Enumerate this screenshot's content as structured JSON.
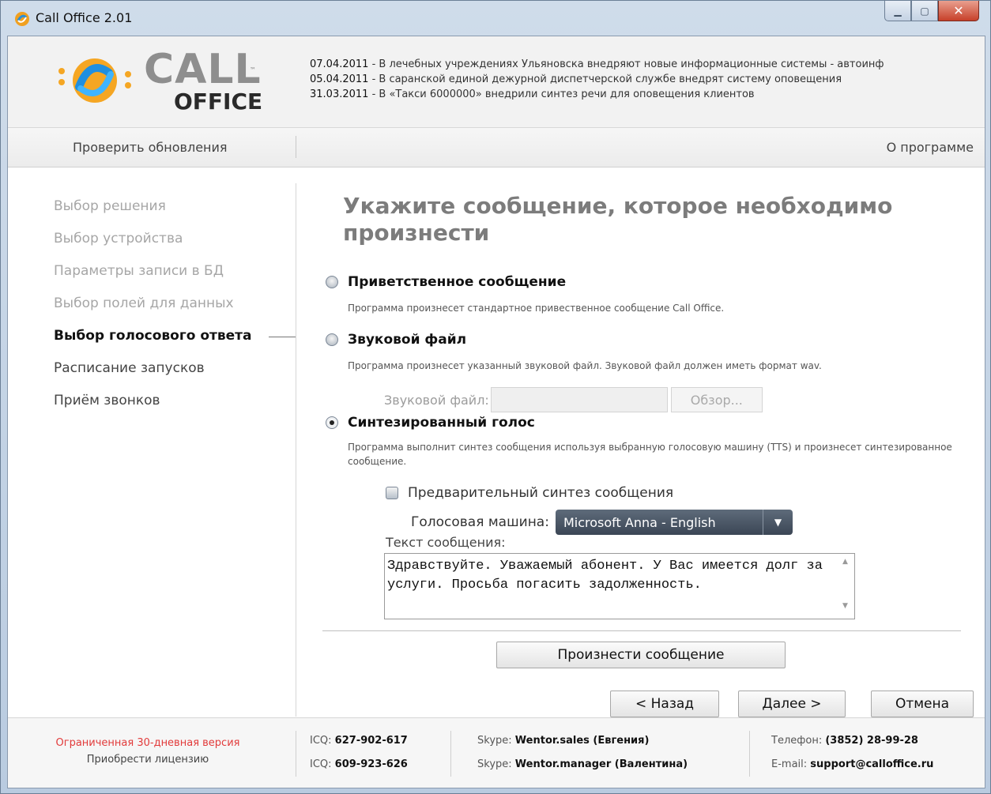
{
  "window": {
    "title": "Call Office 2.01"
  },
  "header": {
    "logo_call": "CALL",
    "logo_office": "OFFICE",
    "logo_tm": "™",
    "news": [
      {
        "date": "07.04.2011",
        "text": " - В лечебных учреждениях Ульяновска внедряют новые информационные системы - автоинф"
      },
      {
        "date": "05.04.2011",
        "text": " - В саранской единой дежурной диспетчерской службе внедрят систему оповещения"
      },
      {
        "date": "31.03.2011",
        "text": " - В «Такси 6000000» внедрили синтез речи для оповещения клиентов"
      }
    ]
  },
  "toolbar": {
    "check_updates": "Проверить обновления",
    "about": "О программе"
  },
  "nav": {
    "items": [
      {
        "label": "Выбор решения",
        "state": "disabled"
      },
      {
        "label": "Выбор устройства",
        "state": "disabled"
      },
      {
        "label": "Параметры записи в БД",
        "state": "disabled"
      },
      {
        "label": "Выбор полей для данных",
        "state": "disabled"
      },
      {
        "label": "Выбор голосового ответа",
        "state": "active"
      },
      {
        "label": "Расписание запусков",
        "state": "normal"
      },
      {
        "label": "Приём звонков",
        "state": "normal"
      }
    ]
  },
  "main": {
    "title": "Укажите сообщение, которое необходимо произнести",
    "options": {
      "greeting": {
        "label": "Приветственное сообщение",
        "desc": "Программа произнесет стандартное привественное сообщение Call Office.",
        "checked": false
      },
      "sound": {
        "label": "Звуковой файл",
        "desc": "Программа произнесет указанный звуковой файл. Звуковой файл должен иметь формат wav.",
        "checked": false
      },
      "synth": {
        "label": "Синтезированный голос",
        "desc": "Программа выполнит синтез сообщения используя выбранную голосовую машину (TTS) и произнесет синтезированное сообщение.",
        "checked": true
      }
    },
    "sound_file_label": "Звуковой файл:",
    "sound_file_value": "",
    "browse_label": "Обзор...",
    "presynth_label": "Предварительный синтез сообщения",
    "engine_label": "Голосовая машина:",
    "engine_value": "Microsoft Anna - English",
    "msg_label": "Текст сообщения:",
    "msg_text": "Здравствуйте. Уважаемый абонент. У Вас имеется долг за услуги. Просьба погасить задолженность.",
    "speak_button": "Произнести сообщение",
    "back_button": "< Назад",
    "next_button": "Далее >",
    "cancel_button": "Отмена"
  },
  "footer": {
    "trial": "Ограниченная 30-дневная версия",
    "buy": "Приобрести лицензию",
    "icq1_label": "ICQ: ",
    "icq1": "627-902-617",
    "icq2_label": "ICQ: ",
    "icq2": "609-923-626",
    "skype1_label": "Skype: ",
    "skype1": "Wentor.sales (Евгения)",
    "skype2_label": "Skype: ",
    "skype2": "Wentor.manager (Валентина)",
    "phone_label": "Телефон: ",
    "phone": "(3852) 28-99-28",
    "email_label": "E-mail: ",
    "email": "support@calloffice.ru"
  },
  "colors": {
    "trial_red": "#e23b3b",
    "select_bg": "#46515f",
    "title_gray": "#7c7c7c"
  }
}
